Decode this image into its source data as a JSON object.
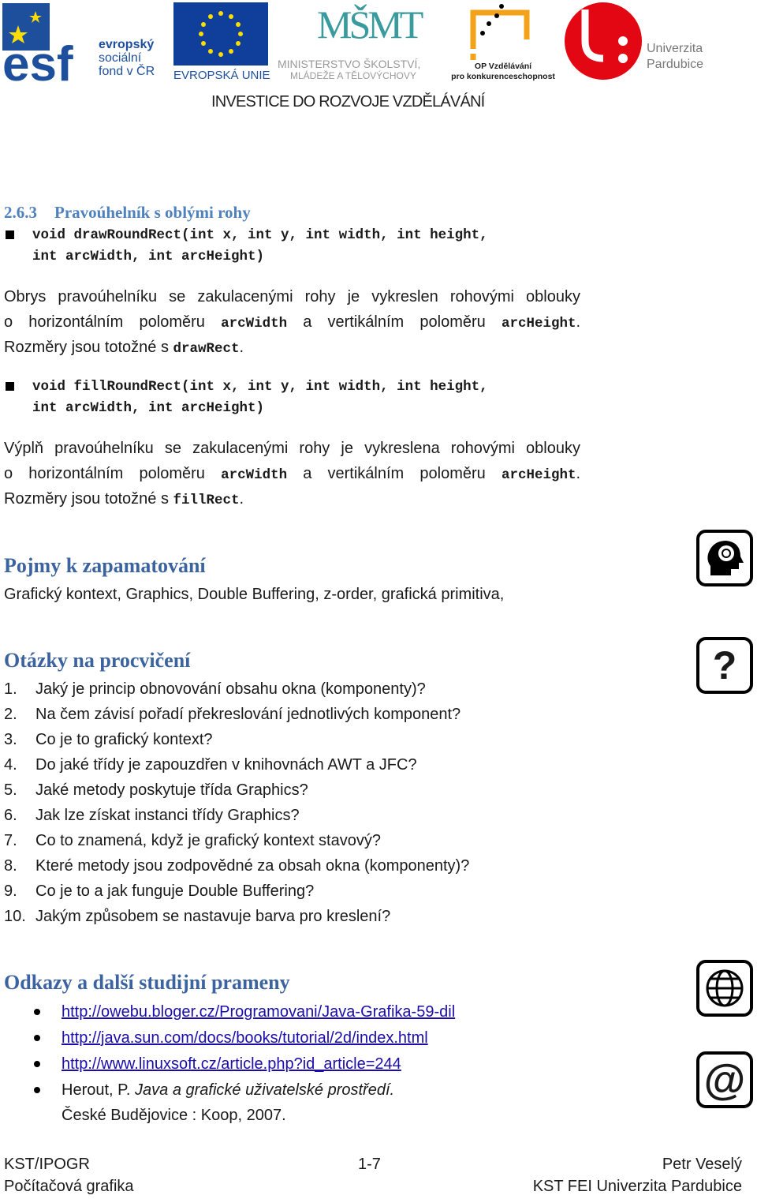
{
  "header": {
    "logos": [
      {
        "name": "esf",
        "lines": [
          "evropský",
          "sociální",
          "fond v ČR"
        ],
        "mark": "esf"
      },
      {
        "name": "eu",
        "caption": "EVROPSKÁ UNIE"
      },
      {
        "name": "msmt",
        "mark": "MŠMT",
        "lines": [
          "MINISTERSTVO ŠKOLSTVÍ,",
          "MLÁDEŽE A TĚLOVÝCHOVY"
        ]
      },
      {
        "name": "op",
        "lines": [
          "OP Vzdělávání",
          "pro konkurenceschopnost"
        ]
      },
      {
        "name": "upce",
        "lines": [
          "Univerzita",
          "Pardubice"
        ]
      }
    ],
    "tagline": "INVESTICE DO ROZVOJE VZDĚLÁVÁNÍ",
    "colors": {
      "esf_blue": "#1d4f9c",
      "eu_blue": "#0f3f9b",
      "star": "#ffdd00",
      "msmt": "#3a9b9e",
      "op": "#f5a21b",
      "upce_red": "#e30613"
    }
  },
  "section": {
    "number": "2.6.3",
    "title": "Pravoúhelník s oblými rohy",
    "method1": {
      "line1": "void drawRoundRect(int x, int y, int width, int height,",
      "line2": "int arcWidth, int arcHeight)"
    },
    "para1": {
      "a": "Obrys pravoúhelníku se zakulacenými rohy je vykreslen rohovými oblouky",
      "b1": "o horizontálním poloměru ",
      "c1": "arcWidth",
      "b2": " a vertikálním poloměru ",
      "c2": "arcHeight",
      "b3": ".",
      "d1": "Rozměry jsou totožné s ",
      "d2": "drawRect",
      "d3": "."
    },
    "method2": {
      "line1": "void fillRoundRect(int x, int y, int width, int height,",
      "line2": "int arcWidth, int arcHeight)"
    },
    "para2": {
      "a": "Výplň pravoúhelníku se zakulacenými rohy je vykreslena rohovými oblouky",
      "b1": "o horizontálním poloměru ",
      "c1": "arcWidth",
      "b2": " a vertikálním poloměru ",
      "c2": "arcHeight",
      "b3": ".",
      "d1": "Rozměry jsou totožné s ",
      "d2": "fillRect",
      "d3": "."
    }
  },
  "terms": {
    "title": "Pojmy k zapamatování",
    "text": "Grafický kontext, Graphics, Double Buffering, z-order, grafická primitiva,"
  },
  "questions": {
    "title": "Otázky na procvičení",
    "items": [
      {
        "n": "1.",
        "t": "Jaký je princip obnovování obsahu okna (komponenty)?"
      },
      {
        "n": "2.",
        "t": "Na čem závisí pořadí překreslování jednotlivých komponent?"
      },
      {
        "n": "3.",
        "t": "Co je to grafický kontext?"
      },
      {
        "n": "4.",
        "t": "Do jaké třídy je zapouzdřen v knihovnách AWT a JFC?"
      },
      {
        "n": "5.",
        "t": "Jaké metody poskytuje třída Graphics?"
      },
      {
        "n": "6.",
        "t": "Jak lze získat instanci třídy Graphics?"
      },
      {
        "n": "7.",
        "t": "Co to znamená, když je grafický kontext stavový?"
      },
      {
        "n": "8.",
        "t": "Které metody jsou zodpovědné za obsah okna (komponenty)?"
      },
      {
        "n": "9.",
        "t": "Co je to a jak funguje Double Buffering?"
      },
      {
        "n": "10.",
        "t": "Jakým způsobem se nastavuje barva pro kreslení?"
      }
    ]
  },
  "links": {
    "title": "Odkazy a další studijní prameny",
    "urls": [
      "http://owebu.bloger.cz/Programovani/Java-Grafika-59-dil",
      "http://java.sun.com/docs/books/tutorial/2d/index.html",
      "http://www.linuxsoft.cz/article.php?id_article=244"
    ],
    "book": {
      "author": "Herout, P. ",
      "title": "Java a grafické uživatelské prostředí.",
      "place": "České Budějovice : Koop, 2007."
    }
  },
  "icons": [
    "head-brain-icon",
    "question-icon",
    "globe-icon",
    "at-sign-icon"
  ],
  "footer": {
    "left1": "KST/IPOGR",
    "left2": "Počítačová grafika",
    "center": "1-7",
    "right1": "Petr Veselý",
    "right2": "KST FEI Univerzita Pardubice"
  }
}
